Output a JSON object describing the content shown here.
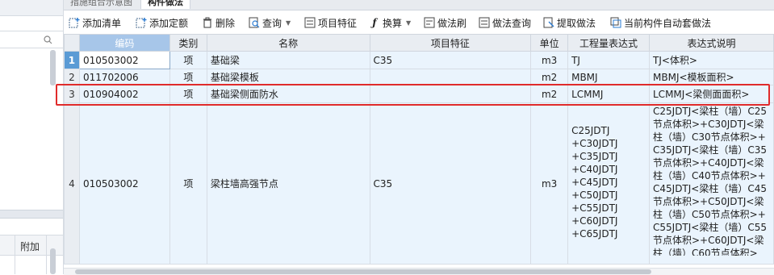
{
  "tabs": [
    "措施组合示意图",
    "构件做法"
  ],
  "toolbar": [
    {
      "label": "添加清单",
      "icon": "add-list-icon"
    },
    {
      "label": "添加定额",
      "icon": "add-quota-icon"
    },
    {
      "label": "删除",
      "icon": "trash-icon"
    },
    {
      "label": "查询",
      "icon": "query-icon"
    },
    {
      "label": "项目特征",
      "icon": "feature-icon"
    },
    {
      "label": "换算",
      "icon": "fx-icon"
    },
    {
      "label": "做法刷",
      "icon": "brush-icon"
    },
    {
      "label": "做法查询",
      "icon": "method-query-icon"
    },
    {
      "label": "提取做法",
      "icon": "extract-icon"
    },
    {
      "label": "当前构件自动套做法",
      "icon": "auto-apply-icon"
    }
  ],
  "columns": [
    "编码",
    "类别",
    "名称",
    "项目特征",
    "单位",
    "工程量表达式",
    "表达式说明"
  ],
  "rows": [
    {
      "num": "1",
      "code": "010503002",
      "type": "项",
      "name": "基础梁",
      "feature": "C35",
      "unit": "m3",
      "expr": "TJ",
      "desc": "TJ<体积>"
    },
    {
      "num": "2",
      "code": "011702006",
      "type": "项",
      "name": "基础梁模板",
      "feature": "",
      "unit": "m2",
      "expr": "MBMJ",
      "desc": "MBMJ<模板面积>"
    },
    {
      "num": "3",
      "code": "010904002",
      "type": "项",
      "name": "基础梁侧面防水",
      "feature": "",
      "unit": "m2",
      "expr": "LCMMJ",
      "desc": "LCMMJ<梁侧面面积>"
    },
    {
      "num": "4",
      "code": "010503002",
      "type": "项",
      "name": "梁柱墙高强节点",
      "feature": "C35",
      "unit": "m3",
      "expr": "C25JDTJ\n+C30JDTJ\n+C35JDTJ\n+C40JDTJ\n+C45JDTJ\n+C50JDTJ\n+C55JDTJ\n+C60JDTJ\n+C65JDTJ",
      "desc": "C25JDTJ<梁柱（墙）C25节点体积>+C30JDTJ<梁柱（墙）C30节点体积>+C35JDTJ<梁柱（墙）C35节点体积>+C40JDTJ<梁柱（墙）C40节点体积>+C45JDTJ<梁柱（墙）C45节点体积>+C50JDTJ<梁柱（墙）C50节点体积>+C55JDTJ<梁柱（墙）C55节点体积>+C60JDTJ<梁柱（墙）C60节点体积>"
    }
  ],
  "left_panel": {
    "column_label": "附加"
  }
}
